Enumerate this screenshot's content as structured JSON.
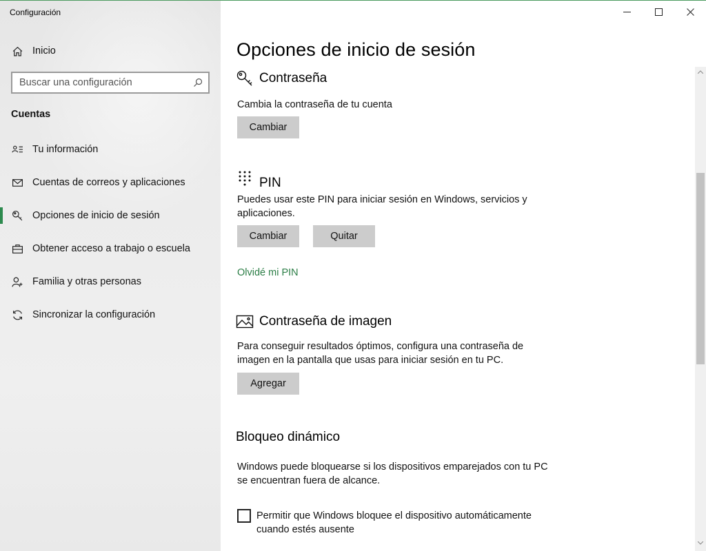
{
  "window": {
    "title": "Configuración"
  },
  "sidebar": {
    "home_label": "Inicio",
    "search_placeholder": "Buscar una configuración",
    "section_heading": "Cuentas",
    "items": [
      {
        "label": "Tu información",
        "icon": "person-card-icon"
      },
      {
        "label": "Cuentas de correos y aplicaciones",
        "icon": "mail-icon"
      },
      {
        "label": "Opciones de inicio de sesión",
        "icon": "key-icon",
        "active": true
      },
      {
        "label": "Obtener acceso a trabajo o escuela",
        "icon": "briefcase-icon"
      },
      {
        "label": "Familia y otras personas",
        "icon": "person-add-icon"
      },
      {
        "label": "Sincronizar la configuración",
        "icon": "sync-icon"
      }
    ]
  },
  "content": {
    "page_title": "Opciones de inicio de sesión",
    "password": {
      "title": "Contraseña",
      "description": "Cambia la contraseña de tu cuenta",
      "change_label": "Cambiar"
    },
    "pin": {
      "title": "PIN",
      "description": "Puedes usar este PIN para iniciar sesión en Windows, servicios y aplicaciones.",
      "change_label": "Cambiar",
      "remove_label": "Quitar",
      "forgot_link": "Olvidé mi PIN"
    },
    "picture_password": {
      "title": "Contraseña de imagen",
      "description": "Para conseguir resultados óptimos, configura una contraseña de imagen en la pantalla que usas para iniciar sesión en tu PC.",
      "add_label": "Agregar"
    },
    "dynamic_lock": {
      "title": "Bloqueo dinámico",
      "description": "Windows puede bloquearse si los dispositivos emparejados con tu PC se encuentran fuera de alcance.",
      "checkbox_label": "Permitir que Windows bloquee el dispositivo automáticamente cuando estés ausente",
      "checked": false
    }
  },
  "colors": {
    "accent": "#2d8a4e",
    "link": "#2a7d45",
    "button_bg": "#cccccc",
    "sidebar_bg": "#ececec"
  }
}
